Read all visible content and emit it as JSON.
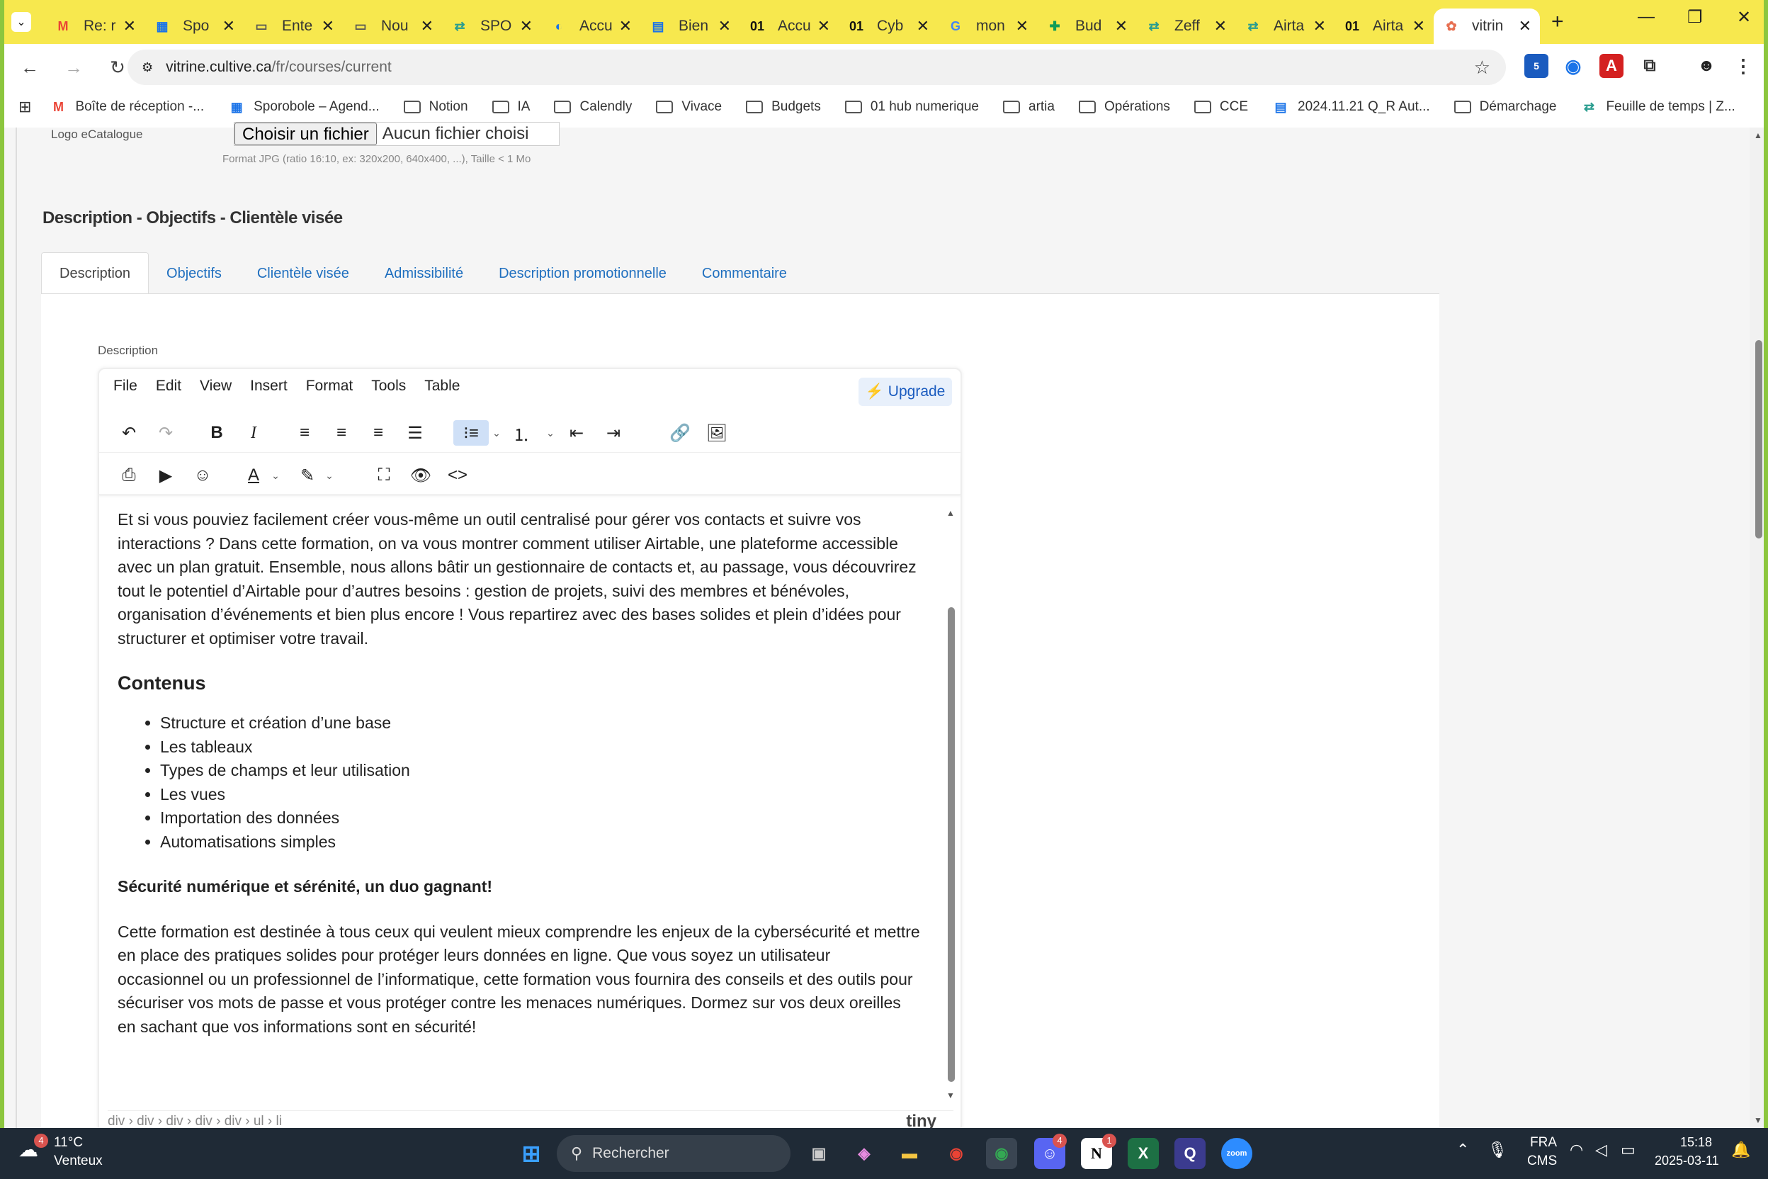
{
  "browser": {
    "tabs": [
      {
        "label": "Re: r",
        "icon": "gmail-icon"
      },
      {
        "label": "Spo",
        "icon": "calendar-icon"
      },
      {
        "label": "Ente",
        "icon": "folder-icon"
      },
      {
        "label": "Nou",
        "icon": "folder-icon"
      },
      {
        "label": "SPO",
        "icon": "arrows-icon"
      },
      {
        "label": "Accu",
        "icon": "circle-icon"
      },
      {
        "label": "Bien",
        "icon": "form-icon"
      },
      {
        "label": "Accu",
        "icon": "o1-icon"
      },
      {
        "label": "Cyb",
        "icon": "o1-icon"
      },
      {
        "label": "mon",
        "icon": "google-icon"
      },
      {
        "label": "Bud",
        "icon": "sheets-icon"
      },
      {
        "label": "Zeff",
        "icon": "arrows-icon"
      },
      {
        "label": "Airta",
        "icon": "arrows-icon"
      },
      {
        "label": "Airta",
        "icon": "o1-icon"
      },
      {
        "label": "vitrin",
        "icon": "vitrine-icon"
      }
    ],
    "url_site": "vitrine.cultive.ca",
    "url_path": "/fr/courses/current",
    "bookmarks": [
      {
        "label": "Boîte de réception -...",
        "icon": "gmail-icon"
      },
      {
        "label": "Sporobole – Agend...",
        "icon": "calendar-icon"
      },
      {
        "label": "Notion",
        "icon": "folder-icon"
      },
      {
        "label": "IA",
        "icon": "folder-icon"
      },
      {
        "label": "Calendly",
        "icon": "folder-icon"
      },
      {
        "label": "Vivace",
        "icon": "folder-icon"
      },
      {
        "label": "Budgets",
        "icon": "folder-icon"
      },
      {
        "label": "01 hub numerique",
        "icon": "folder-icon"
      },
      {
        "label": "artia",
        "icon": "folder-icon"
      },
      {
        "label": "Opérations",
        "icon": "folder-icon"
      },
      {
        "label": "CCE",
        "icon": "folder-icon"
      },
      {
        "label": "2024.11.21 Q_R Aut...",
        "icon": "docs-icon"
      },
      {
        "label": "Démarchage",
        "icon": "folder-icon"
      },
      {
        "label": "Feuille de temps | Z...",
        "icon": "arrows-icon"
      }
    ],
    "ext_badge": "5"
  },
  "form": {
    "logo_label": "Logo eCatalogue",
    "file_button": "Choisir un fichier",
    "file_status": "Aucun fichier choisi",
    "file_hint": "Format JPG (ratio 16:10, ex: 320x200, 640x400, ...), Taille < 1 Mo",
    "section_title": "Description - Objectifs - Clientèle visée",
    "tabs": [
      "Description",
      "Objectifs",
      "Clientèle visée",
      "Admissibilité",
      "Description promotionnelle",
      "Commentaire"
    ],
    "description_label": "Description"
  },
  "editor": {
    "menu": [
      "File",
      "Edit",
      "View",
      "Insert",
      "Format",
      "Tools",
      "Table"
    ],
    "upgrade": "Upgrade",
    "intro": "Et si vous pouviez facilement créer vous-même un outil centralisé pour gérer vos contacts et suivre vos interactions ? Dans cette formation, on va vous montrer comment utiliser Airtable, une plateforme accessible avec un plan gratuit. Ensemble, nous allons bâtir un gestionnaire de contacts et, au passage, vous découvrirez tout le potentiel d’Airtable pour d’autres besoins : gestion de projets, suivi des membres et bénévoles, organisation d’événements et bien plus encore ! Vous repartirez avec des bases solides et plein d’idées pour structurer et optimiser votre travail.",
    "heading": "Contenus",
    "items": [
      "Structure et création d’une base",
      "Les tableaux",
      "Types de champs et leur utilisation",
      "Les vues",
      "Importation des données",
      "Automatisations simples"
    ],
    "bold_line": "Sécurité numérique et sérénité, un duo gagnant!",
    "paragraph2": "Cette formation est destinée à tous ceux qui veulent mieux comprendre les enjeux de la cybersécurité et mettre en place des pratiques solides pour protéger leurs données en ligne. Que vous soyez un utilisateur occasionnel ou un professionnel de l’informatique, cette formation vous fournira des conseils et des outils pour sécuriser vos mots de passe et vous protéger contre les menaces numériques. Dormez sur vos deux oreilles en sachant que vos informations sont en sécurité!",
    "path": "div › div › div › div › div › ul › li",
    "brand": "tiny"
  },
  "taskbar": {
    "weather_temp": "11°C",
    "weather_desc": "Venteux",
    "weather_badge": "4",
    "search": "Rechercher",
    "lang": "FRA",
    "layout": "CMS",
    "time": "15:18",
    "date": "2025-03-11",
    "discord_badge": "4",
    "notion_badge": "1"
  },
  "colors": {
    "tab_strip": "#f7e84e",
    "link": "#1f6fbf",
    "frame": "#8cc63e"
  }
}
